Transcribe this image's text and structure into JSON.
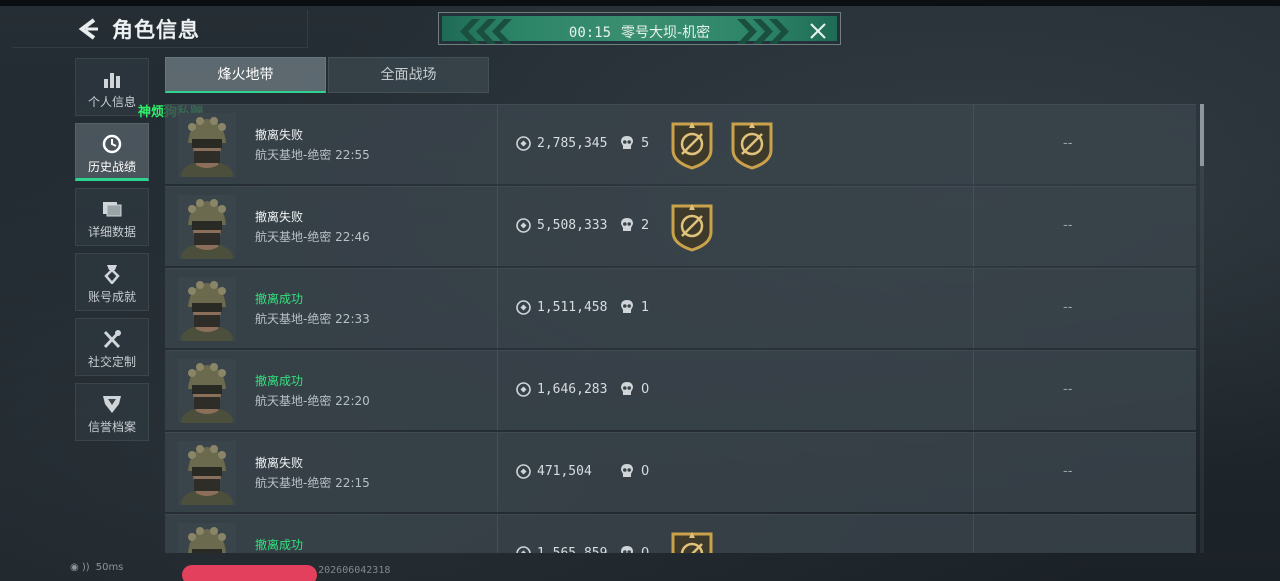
{
  "header": {
    "title": "角色信息"
  },
  "match_banner": {
    "time": "00:15",
    "mode": "零号大坝-机密"
  },
  "sidebar": {
    "items": [
      {
        "label": "个人信息",
        "icon": "bar-chart-icon"
      },
      {
        "label": "历史战绩",
        "icon": "clock-icon",
        "active": true
      },
      {
        "label": "详细数据",
        "icon": "folder-icon"
      },
      {
        "label": "账号成就",
        "icon": "medal-icon"
      },
      {
        "label": "社交定制",
        "icon": "tools-icon"
      },
      {
        "label": "信誉档案",
        "icon": "shield-icon"
      }
    ]
  },
  "watermark": "神烦狗私蹦",
  "tabs": [
    {
      "label": "烽火地带",
      "active": true
    },
    {
      "label": "全面战场",
      "active": false
    }
  ],
  "matches": [
    {
      "status": "撤离失败",
      "success": false,
      "map": "航天基地-绝密",
      "time": "22:55",
      "value": "2,785,345",
      "kills": "5",
      "medals": 2,
      "extra": "--"
    },
    {
      "status": "撤离失败",
      "success": false,
      "map": "航天基地-绝密",
      "time": "22:46",
      "value": "5,508,333",
      "kills": "2",
      "medals": 1,
      "extra": "--"
    },
    {
      "status": "撤离成功",
      "success": true,
      "map": "航天基地-绝密",
      "time": "22:33",
      "value": "1,511,458",
      "kills": "1",
      "medals": 0,
      "extra": "--"
    },
    {
      "status": "撤离成功",
      "success": true,
      "map": "航天基地-绝密",
      "time": "22:20",
      "value": "1,646,283",
      "kills": "0",
      "medals": 0,
      "extra": "--"
    },
    {
      "status": "撤离失败",
      "success": false,
      "map": "航天基地-绝密",
      "time": "22:15",
      "value": "471,504",
      "kills": "0",
      "medals": 0,
      "extra": "--"
    },
    {
      "status": "撤离成功",
      "success": true,
      "map": "",
      "time": "",
      "value": "1,565,859",
      "kills": "0",
      "medals": 1,
      "extra": ""
    }
  ],
  "statusbar": {
    "ping": "50ms",
    "build": "39225 202606042318"
  },
  "colors": {
    "accent_green": "#2fd38f",
    "success_text": "#33e07e",
    "banner": "#2d8568",
    "medal_gold": "#c9a24b"
  }
}
